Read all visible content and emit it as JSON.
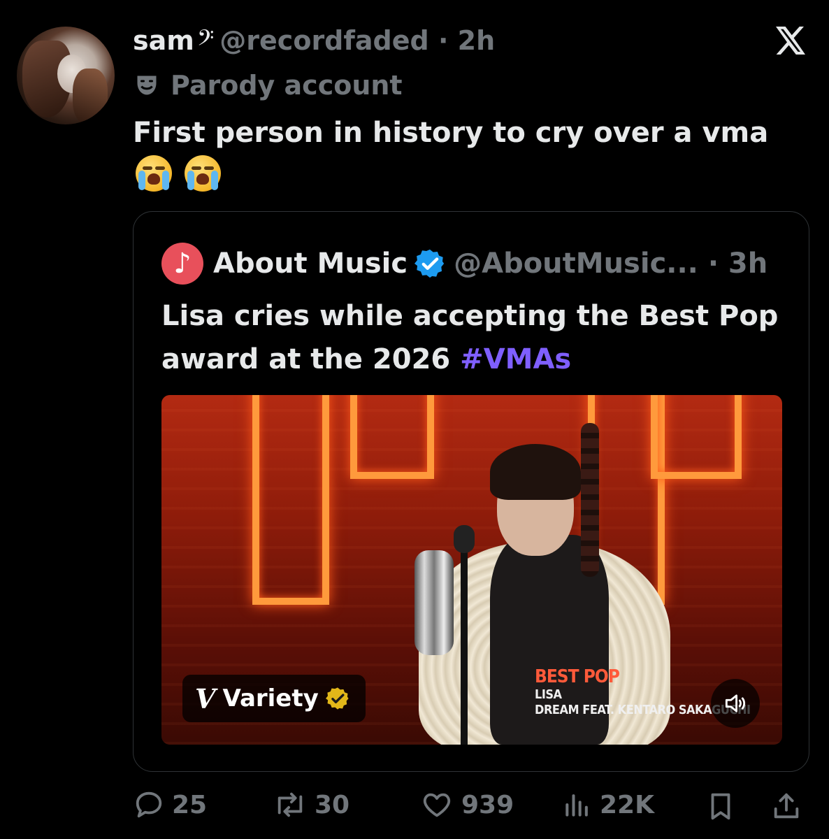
{
  "author": {
    "display_name": "sam",
    "name_glyph": "𝄢",
    "handle": "@recordfaded",
    "time": "· 2h",
    "label": "Parody account"
  },
  "tweet": {
    "text": "First person in history to cry over a vma",
    "emojis": [
      "loudly-crying-face",
      "loudly-crying-face"
    ]
  },
  "quote": {
    "display_name": "About Music",
    "avatar_glyph": "♪",
    "handle": "@AboutMusic...",
    "time": "· 3h",
    "text_main": "Lisa cries while accepting the Best Pop award at the 2026 ",
    "hashtag": "#VMAs",
    "media": {
      "source_badge": "Variety",
      "source_badge_letter": "V",
      "lower_third_title": "BEST POP",
      "lower_third_artist": "LISA",
      "lower_third_song": "DREAM FEAT. KENTARO SAKAGUCHI",
      "volume_icon": "speaker-icon"
    }
  },
  "actions": {
    "replies": "25",
    "reposts": "30",
    "likes": "939",
    "views": "22K"
  },
  "colors": {
    "background": "#000000",
    "text_primary": "#e7e9ea",
    "text_secondary": "#71767b",
    "hashtag": "#7f5fff",
    "verified_blue": "#1d9bf0",
    "verified_gold": "#e2b719",
    "quote_avatar": "#e8505b"
  }
}
